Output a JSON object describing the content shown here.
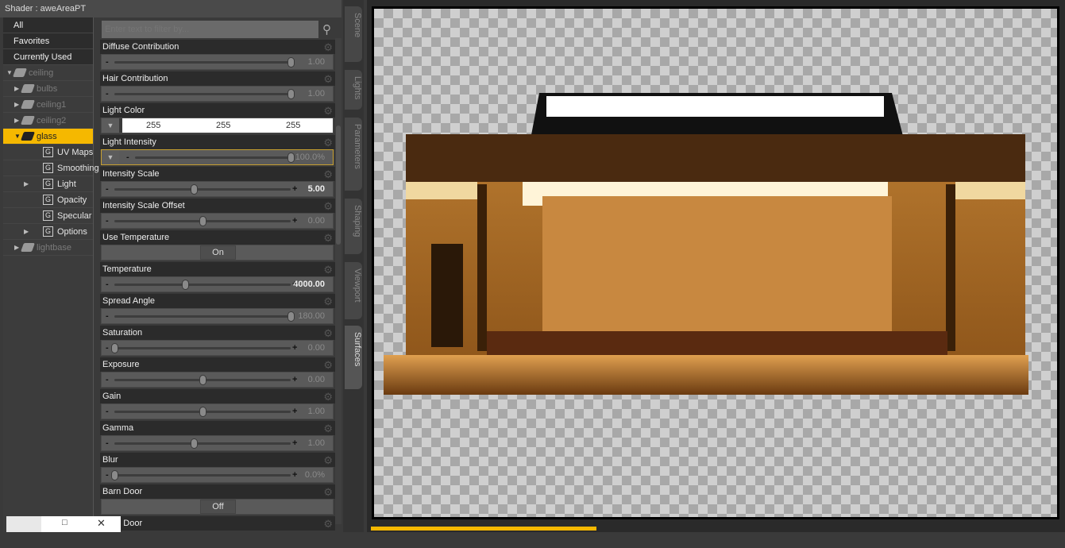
{
  "title": "Shader : aweAreaPT",
  "categories": [
    "All",
    "Favorites",
    "Currently Used"
  ],
  "tree": [
    {
      "label": "ceiling",
      "level": 0,
      "arrow": "▼",
      "icon": "cube",
      "dim": true
    },
    {
      "label": "bulbs",
      "level": 1,
      "arrow": "▶",
      "icon": "material",
      "dim": true
    },
    {
      "label": "ceiling1",
      "level": 1,
      "arrow": "▶",
      "icon": "material",
      "dim": true
    },
    {
      "label": "ceiling2",
      "level": 1,
      "arrow": "▶",
      "icon": "material",
      "dim": true
    },
    {
      "label": "glass",
      "level": 1,
      "arrow": "▼",
      "icon": "material",
      "selected": true
    },
    {
      "label": "UV Maps",
      "level": 2,
      "arrow": "",
      "icon": "G"
    },
    {
      "label": "Smoothing",
      "level": 2,
      "arrow": "",
      "icon": "G"
    },
    {
      "label": "Light",
      "level": 2,
      "arrow": "▶",
      "icon": "G"
    },
    {
      "label": "Opacity",
      "level": 2,
      "arrow": "",
      "icon": "G"
    },
    {
      "label": "Specular",
      "level": 2,
      "arrow": "",
      "icon": "G"
    },
    {
      "label": "Options",
      "level": 2,
      "arrow": "▶",
      "icon": "G"
    },
    {
      "label": "lightbase",
      "level": 1,
      "arrow": "▶",
      "icon": "material",
      "dim": true
    }
  ],
  "filter_placeholder": "Enter text to filter by...",
  "params": [
    {
      "label": "Diffuse Contribution",
      "type": "slider",
      "value": "1.00",
      "pos": 1.0,
      "plus": false
    },
    {
      "label": "Hair Contribution",
      "type": "slider",
      "value": "1.00",
      "pos": 1.0,
      "plus": false
    },
    {
      "label": "Light Color",
      "type": "color",
      "rgb": [
        "255",
        "255",
        "255"
      ]
    },
    {
      "label": "Light Intensity",
      "type": "slider",
      "value": "100.0%",
      "pos": 1.0,
      "plus": false,
      "dropdown": true,
      "highlight": true
    },
    {
      "label": "Intensity Scale",
      "type": "slider",
      "value": "5.00",
      "pos": 0.45,
      "plus": true,
      "bold": true
    },
    {
      "label": "Intensity Scale Offset",
      "type": "slider",
      "value": "0.00",
      "pos": 0.5,
      "plus": true
    },
    {
      "label": "Use Temperature",
      "type": "toggle",
      "value": "On"
    },
    {
      "label": "Temperature",
      "type": "slider",
      "value": "4000.00",
      "pos": 0.4,
      "plus": true,
      "bold": true
    },
    {
      "label": "Spread Angle",
      "type": "slider",
      "value": "180.00",
      "pos": 1.0,
      "plus": false
    },
    {
      "label": "Saturation",
      "type": "slider",
      "value": "0.00",
      "pos": 0.0,
      "plus": true
    },
    {
      "label": "Exposure",
      "type": "slider",
      "value": "0.00",
      "pos": 0.5,
      "plus": true
    },
    {
      "label": "Gain",
      "type": "slider",
      "value": "1.00",
      "pos": 0.5,
      "plus": true
    },
    {
      "label": "Gamma",
      "type": "slider",
      "value": "1.00",
      "pos": 0.45,
      "plus": true
    },
    {
      "label": "Blur",
      "type": "slider",
      "value": "0.0%",
      "pos": 0.0,
      "plus": true
    },
    {
      "label": "Barn Door",
      "type": "toggle",
      "value": "Off"
    },
    {
      "label": "Barn Door",
      "type": "header"
    }
  ],
  "side_tabs": [
    "Scene",
    "Lights",
    "Parameters",
    "Shaping",
    "Viewport",
    "Surfaces"
  ],
  "active_tab": "Surfaces",
  "render_progress": 0.33,
  "accent": "#f5b800"
}
